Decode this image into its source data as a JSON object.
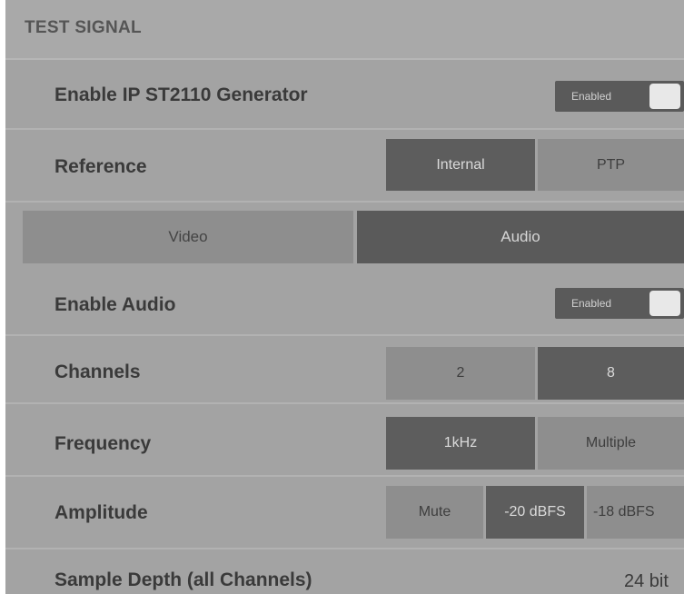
{
  "panel": {
    "title": "TEST SIGNAL"
  },
  "generator": {
    "label": "Enable IP ST2110 Generator",
    "toggle_text": "Enabled"
  },
  "reference": {
    "label": "Reference",
    "options": [
      "Internal",
      "PTP"
    ],
    "selected": "Internal"
  },
  "tabs": {
    "items": [
      "Video",
      "Audio"
    ],
    "selected": "Audio"
  },
  "audio": {
    "enable_label": "Enable Audio",
    "enable_toggle_text": "Enabled",
    "channels": {
      "label": "Channels",
      "options": [
        "2",
        "8"
      ],
      "selected": "8"
    },
    "frequency": {
      "label": "Frequency",
      "options": [
        "1kHz",
        "Multiple"
      ],
      "selected": "1kHz"
    },
    "amplitude": {
      "label": "Amplitude",
      "options": [
        "Mute",
        "-20 dBFS",
        "-18 dBFS"
      ],
      "selected": "-20 dBFS"
    },
    "sample_depth": {
      "label": "Sample Depth (all Channels)",
      "value": "24 bit"
    }
  },
  "colors": {
    "panel_bg": "#a3a3a3",
    "selected_bg": "#5d5d5d",
    "unselected_bg": "#8e8e8e",
    "label_text": "#3a3a3a"
  }
}
